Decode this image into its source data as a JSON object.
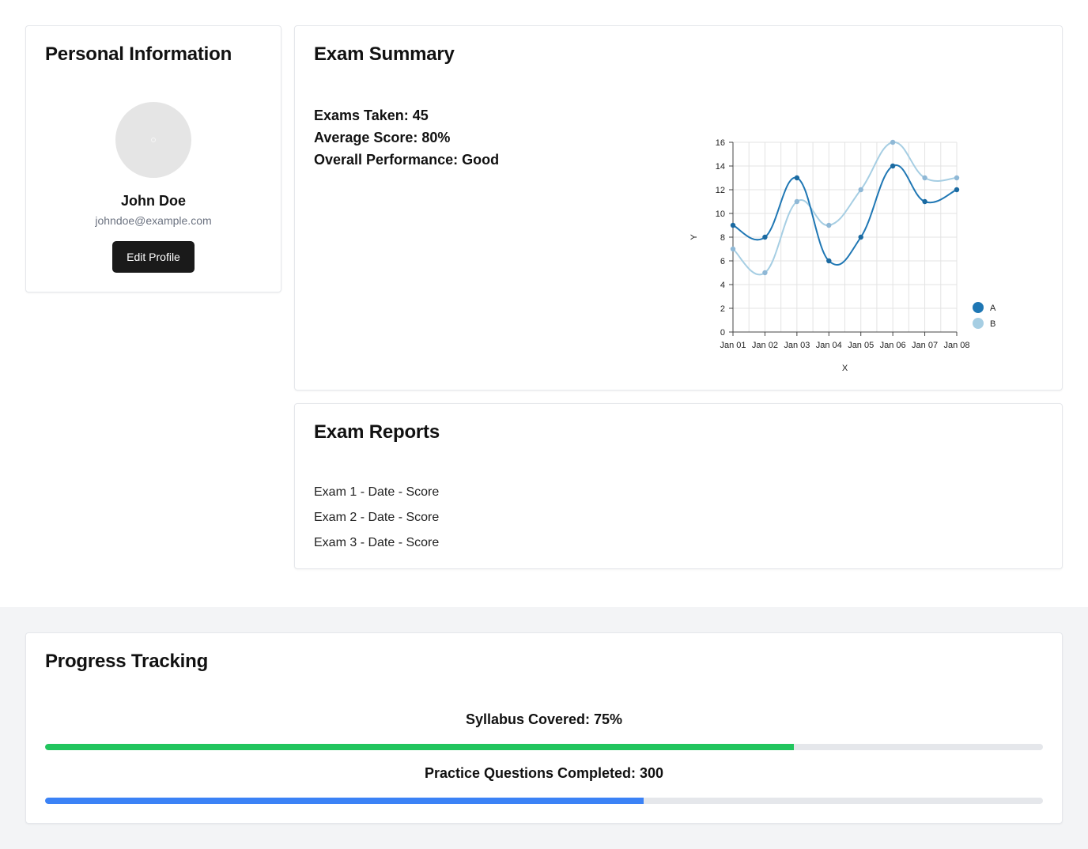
{
  "personal": {
    "title": "Personal Information",
    "name": "John Doe",
    "email": "johndoe@example.com",
    "edit_button": "Edit Profile"
  },
  "summary": {
    "title": "Exam Summary",
    "exams_taken": "Exams Taken: 45",
    "average_score": "Average Score: 80%",
    "overall_performance": "Overall Performance: Good"
  },
  "chart_data": {
    "type": "line",
    "x": [
      "Jan 01",
      "Jan 02",
      "Jan 03",
      "Jan 04",
      "Jan 05",
      "Jan 06",
      "Jan 07",
      "Jan 08"
    ],
    "series": [
      {
        "name": "A",
        "values": [
          9,
          8,
          13,
          6,
          8,
          14,
          11,
          12
        ],
        "color": "#1f77b4"
      },
      {
        "name": "B",
        "values": [
          7,
          5,
          11,
          9,
          12,
          16,
          13,
          13
        ],
        "color": "#a6cee3"
      }
    ],
    "xlabel": "X",
    "ylabel": "Y",
    "ylim": [
      0,
      16
    ],
    "yticks": [
      0,
      2,
      4,
      6,
      8,
      10,
      12,
      14,
      16
    ],
    "grid": true,
    "legend": "right"
  },
  "reports": {
    "title": "Exam Reports",
    "items": [
      "Exam 1 - Date - Score",
      "Exam 2 - Date - Score",
      "Exam 3 - Date - Score"
    ]
  },
  "progress": {
    "title": "Progress Tracking",
    "syllabus_label": "Syllabus Covered: 75%",
    "syllabus_fraction": 0.75,
    "syllabus_color": "#22c55e",
    "practice_label": "Practice Questions Completed: 300",
    "practice_fraction": 0.6,
    "practice_color": "#3b82f6"
  }
}
